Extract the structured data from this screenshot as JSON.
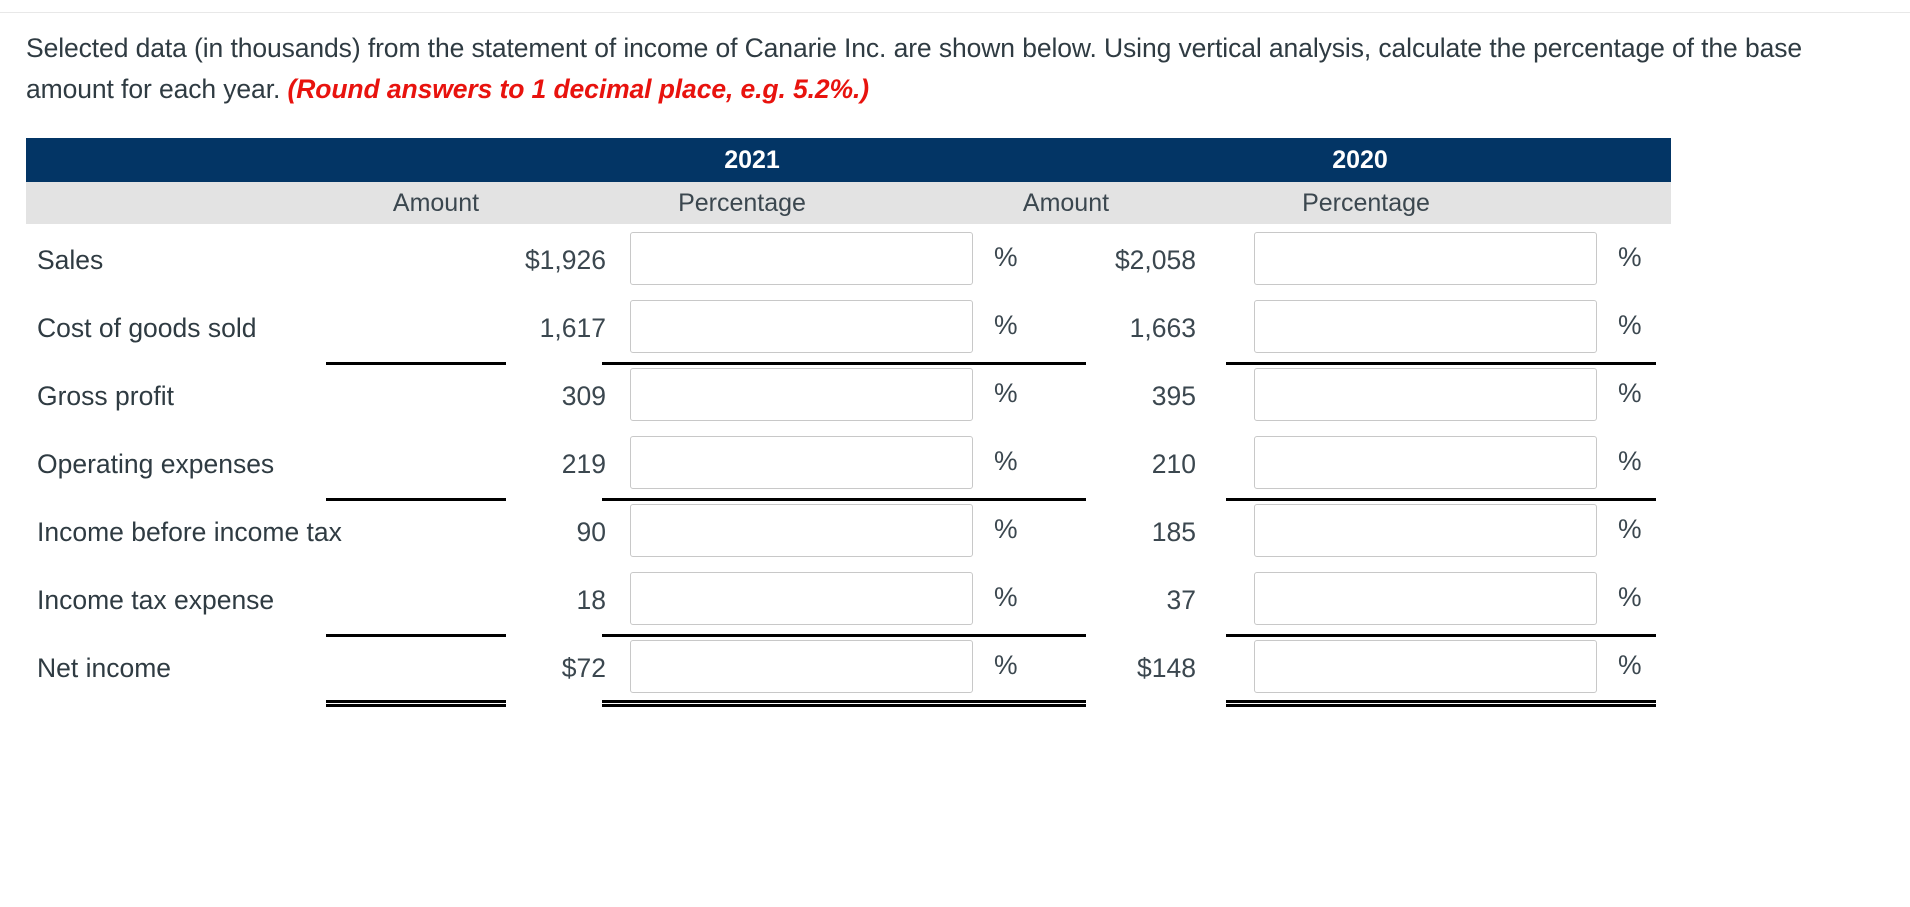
{
  "instructions": {
    "line1": "Selected data (in thousands) from the statement of income of Canarie Inc. are shown below. Using vertical analysis, calculate the percentage of the base amount for each year.",
    "hint": "(Round answers to 1 decimal place, e.g. 5.2%.)"
  },
  "table": {
    "years": {
      "y2021": "2021",
      "y2020": "2020"
    },
    "subheaders": {
      "amount_2021": "Amount",
      "percentage_2021": "Percentage",
      "amount_2020": "Amount",
      "percentage_2020": "Percentage"
    },
    "percent_sign": "%",
    "percent_placeholder": "",
    "rows": [
      {
        "label": "Sales",
        "amount_2021": "$1,926",
        "percent_2021": "",
        "amount_2020": "$2,058",
        "percent_2020": "",
        "rule": "none"
      },
      {
        "label": "Cost of goods sold",
        "amount_2021": "1,617",
        "percent_2021": "",
        "amount_2020": "1,663",
        "percent_2020": "",
        "rule": "single"
      },
      {
        "label": "Gross profit",
        "amount_2021": "309",
        "percent_2021": "",
        "amount_2020": "395",
        "percent_2020": "",
        "rule": "none"
      },
      {
        "label": "Operating expenses",
        "amount_2021": "219",
        "percent_2021": "",
        "amount_2020": "210",
        "percent_2020": "",
        "rule": "single"
      },
      {
        "label": "Income before income tax",
        "amount_2021": "90",
        "percent_2021": "",
        "amount_2020": "185",
        "percent_2020": "",
        "rule": "none"
      },
      {
        "label": "Income tax expense",
        "amount_2021": "18",
        "percent_2021": "",
        "amount_2020": "37",
        "percent_2020": "",
        "rule": "single"
      },
      {
        "label": "Net income",
        "amount_2021": "$72",
        "percent_2021": "",
        "amount_2020": "$148",
        "percent_2020": "",
        "rule": "double"
      }
    ]
  },
  "colors": {
    "header_navy": "#033565",
    "subheader_gray": "#e3e3e3",
    "hint_red": "#e8130e",
    "text": "#2f3b42",
    "input_border": "#c8c8c8"
  }
}
